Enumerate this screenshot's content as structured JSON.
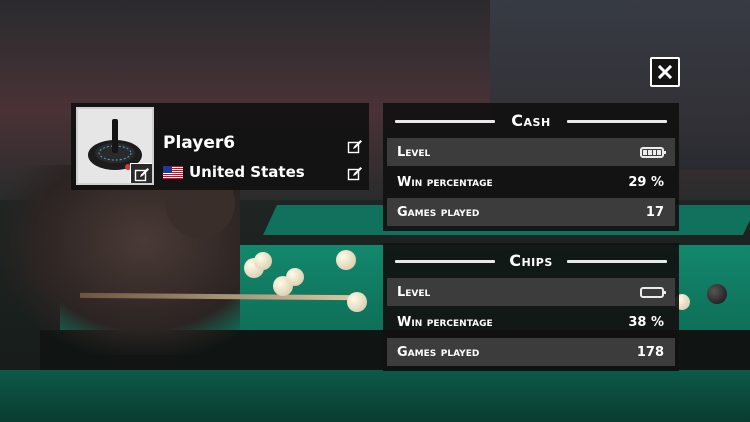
{
  "close": {
    "icon": "close-icon"
  },
  "profile": {
    "avatar_icon": "joystick-icon",
    "player_name": "Player6",
    "country": "United States",
    "flag_icon": "us-flag-icon",
    "edit_icon": "edit-icon"
  },
  "panels": [
    {
      "title": "Cash",
      "rows": [
        {
          "label": "Level",
          "level_fill": 1.0
        },
        {
          "label": "Win percentage",
          "value": "29 %"
        },
        {
          "label": "Games played",
          "value": "17"
        }
      ]
    },
    {
      "title": "Chips",
      "rows": [
        {
          "label": "Level",
          "level_fill": 0.0
        },
        {
          "label": "Win percentage",
          "value": "38 %"
        },
        {
          "label": "Games played",
          "value": "178"
        }
      ]
    }
  ],
  "colors": {
    "panel_bg": "#111111",
    "row_shade": "#3c3c3c",
    "felt": "#0f7a64"
  }
}
